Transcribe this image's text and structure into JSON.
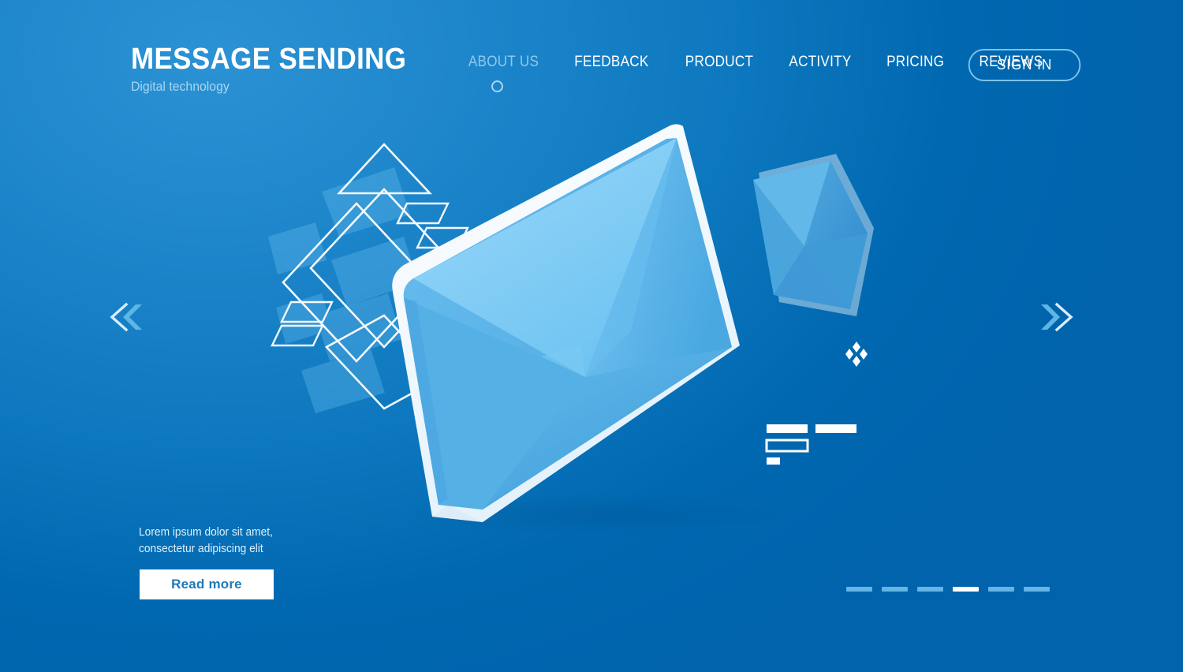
{
  "brand": {
    "title": "MESSAGE SENDING",
    "subtitle": "Digital technology"
  },
  "nav": {
    "items": [
      {
        "label": "ABOUT US",
        "active": true
      },
      {
        "label": "FEEDBACK",
        "active": false
      },
      {
        "label": "PRODUCT",
        "active": false
      },
      {
        "label": "ACTIVITY",
        "active": false
      },
      {
        "label": "PRICING",
        "active": false
      },
      {
        "label": "REVIEWS",
        "active": false
      }
    ],
    "sign_in_label": "SIGN IN"
  },
  "hero": {
    "description": "Lorem ipsum dolor sit amet, consectetur adipiscing elit",
    "read_more_label": "Read more"
  },
  "carousel": {
    "slide_count": 6,
    "active_index": 3
  },
  "controls": {
    "prev_icon": "double-chevron-left-icon",
    "next_icon": "double-chevron-right-icon"
  },
  "illustration": {
    "main_icon": "envelope-3d-icon",
    "secondary_icon": "envelope-3d-small-icon",
    "sparkle_icon": "four-diamond-sparkle-icon",
    "geometric_icon": "diamond-outline-decoration",
    "bars_icon": "bar-decoration"
  },
  "colors": {
    "background_light": "#2b92d4",
    "background_dark": "#0063ac",
    "envelope_light": "#8ed1f5",
    "envelope_mid": "#64bdf0",
    "envelope_dark": "#4aa9e0",
    "accent_text": "#a9d6f2",
    "white": "#ffffff",
    "button_text": "#1e7ab8"
  }
}
